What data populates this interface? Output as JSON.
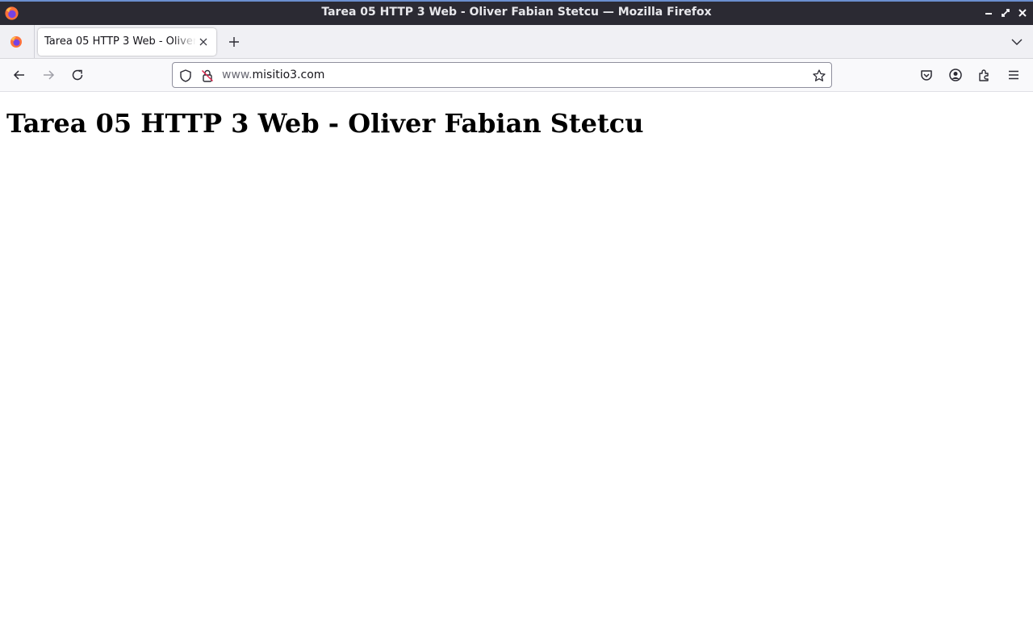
{
  "window": {
    "title": "Tarea 05 HTTP 3 Web - Oliver Fabian Stetcu — Mozilla Firefox"
  },
  "tabs": [
    {
      "title": "Tarea 05 HTTP 3 Web - Oliver Fabian Stetcu",
      "active": true
    }
  ],
  "urlbar": {
    "prefix": "www.",
    "domain": "misitio3.com"
  },
  "page": {
    "heading": "Tarea 05 HTTP 3 Web - Oliver Fabian Stetcu"
  },
  "colors": {
    "titlebar_bg": "#2b2a33",
    "tabbar_bg": "#f0f0f4",
    "navbar_bg": "#f9f9fb",
    "firefox_orange": "#ff7139",
    "firefox_purple": "#7542e5"
  },
  "icons": [
    "firefox-logo-icon",
    "minimize-icon",
    "maximize-icon",
    "close-window-icon",
    "firefox-view-icon",
    "tab-close-icon",
    "new-tab-icon",
    "list-all-tabs-icon",
    "back-icon",
    "forward-icon",
    "reload-icon",
    "shield-icon",
    "insecure-lock-icon",
    "bookmark-star-icon",
    "pocket-icon",
    "account-icon",
    "extensions-icon",
    "menu-icon"
  ]
}
